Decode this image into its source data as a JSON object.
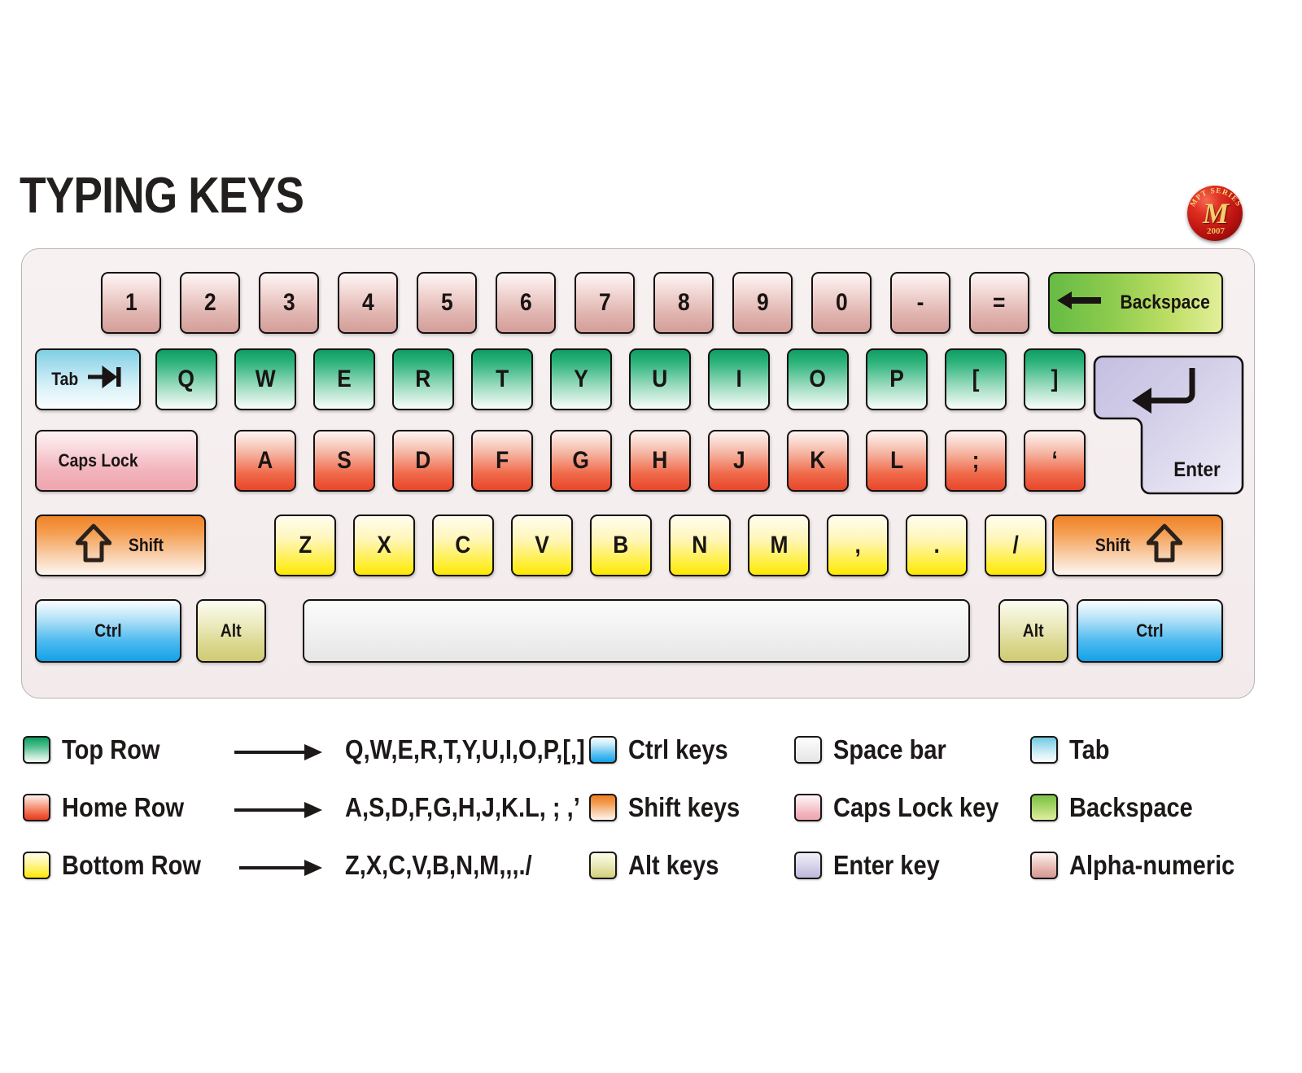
{
  "title": "TYPING KEYS",
  "logo": {
    "arc_text": "MPT SERIES",
    "monogram": "M",
    "year": "2007"
  },
  "keyboard": {
    "number_row": {
      "keys": [
        "1",
        "2",
        "3",
        "4",
        "5",
        "6",
        "7",
        "8",
        "9",
        "0",
        "-",
        "="
      ],
      "backspace_label": "Backspace",
      "backspace_icon": "arrow-left-icon"
    },
    "top_row": {
      "tab_label": "Tab",
      "tab_icon": "tab-arrow-icon",
      "keys": [
        "Q",
        "W",
        "E",
        "R",
        "T",
        "Y",
        "U",
        "I",
        "O",
        "P",
        "[",
        "]"
      ],
      "enter_label": "Enter",
      "enter_icon": "enter-arrow-icon"
    },
    "home_row": {
      "caps_lock_label": "Caps Lock",
      "keys": [
        "A",
        "S",
        "D",
        "F",
        "G",
        "H",
        "J",
        "K",
        "L",
        ";",
        "‘"
      ]
    },
    "bottom_row": {
      "shift_left_label": "Shift",
      "shift_right_label": "Shift",
      "shift_icon": "arrow-up-icon",
      "keys": [
        "Z",
        "X",
        "C",
        "V",
        "B",
        "N",
        "M",
        ",",
        ".",
        "/"
      ]
    },
    "modifier_row": {
      "ctrl_left_label": "Ctrl",
      "alt_left_label": "Alt",
      "space_label": "",
      "alt_right_label": "Alt",
      "ctrl_right_label": "Ctrl"
    }
  },
  "legend": {
    "rows": [
      {
        "label": "Top Row",
        "keys": "Q,W,E,R,T,Y,U,I,O,P,[,]",
        "swatch": "sw-top"
      },
      {
        "label": "Home Row",
        "keys": "A,S,D,F,G,H,J,K.L, ; ,’",
        "swatch": "sw-home"
      },
      {
        "label": "Bottom  Row",
        "keys": "Z,X,C,V,B,N,M,,,./",
        "swatch": "sw-bottom"
      }
    ],
    "col2": [
      {
        "label": "Ctrl keys",
        "swatch": "sw-ctrl"
      },
      {
        "label": "Shift keys",
        "swatch": "sw-shift"
      },
      {
        "label": "Alt keys",
        "swatch": "sw-alt"
      }
    ],
    "col3": [
      {
        "label": "Space bar",
        "swatch": "sw-space"
      },
      {
        "label": "Caps Lock key",
        "swatch": "sw-caps"
      },
      {
        "label": "Enter key",
        "swatch": "sw-enter"
      }
    ],
    "col4": [
      {
        "label": "Tab",
        "swatch": "sw-tab"
      },
      {
        "label": "Backspace",
        "swatch": "sw-back"
      },
      {
        "label": "Alpha-numeric",
        "swatch": "sw-alpha"
      }
    ]
  },
  "colors": {
    "top_row": "#0f9d63",
    "home_row": "#ef5e3c",
    "bottom_row": "#ffee3d",
    "ctrl": "#12a2e8",
    "shift": "#ee7f22",
    "alt": "#d2cf78",
    "caps_lock": "#f2b2bb",
    "enter": "#c8c3e3",
    "tab": "#6fc9e0",
    "backspace": "#7cc349",
    "alpha_numeric": "#d59a94",
    "title": "#231f1e",
    "logo": "#ba1210"
  }
}
